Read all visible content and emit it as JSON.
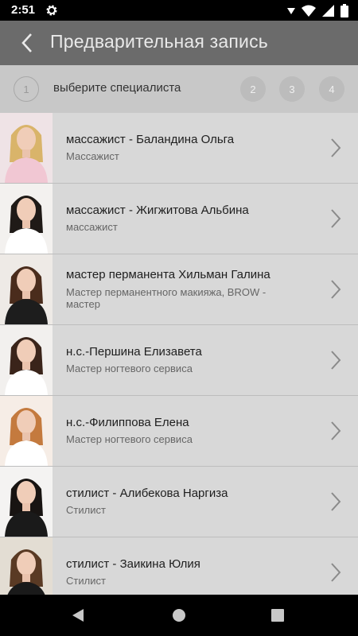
{
  "status_bar": {
    "time": "2:51"
  },
  "header": {
    "title": "Предварительная запись"
  },
  "stepper": {
    "active_step": "1",
    "active_label": "выберите специалиста",
    "steps": [
      "2",
      "3",
      "4"
    ]
  },
  "specialists": [
    {
      "name": "массажист - Баландина Ольга",
      "role": "Массажист",
      "hair": "#d9b46a",
      "bg": "#efe3e6",
      "top": "#f1c7d3"
    },
    {
      "name": "массажист - Жигжитова Альбина",
      "role": "массажист",
      "hair": "#1f1a17",
      "bg": "#f3f1ef",
      "top": "#ffffff"
    },
    {
      "name": "мастер перманента Хильман Галина",
      "role": "Мастер перманентного макияжа, BROW - мастер",
      "hair": "#4a2c1c",
      "bg": "#eeeae6",
      "top": "#1d1d1d"
    },
    {
      "name": "н.с.-Першина Елизавета",
      "role": "Мастер ногтевого сервиса",
      "hair": "#3a241a",
      "bg": "#f2f0ee",
      "top": "#ffffff"
    },
    {
      "name": "н.с.-Филиппова Елена",
      "role": "Мастер ногтевого сервиса",
      "hair": "#c47a3e",
      "bg": "#f6ede6",
      "top": "#ffffff"
    },
    {
      "name": "стилист - Алибекова Наргиза",
      "role": "Стилист",
      "hair": "#181412",
      "bg": "#f4f3f2",
      "top": "#1a1a1a"
    },
    {
      "name": "стилист - Заикина Юлия",
      "role": "Стилист",
      "hair": "#5a3a24",
      "bg": "#e3ddd3",
      "top": "#1a1a1a"
    }
  ]
}
